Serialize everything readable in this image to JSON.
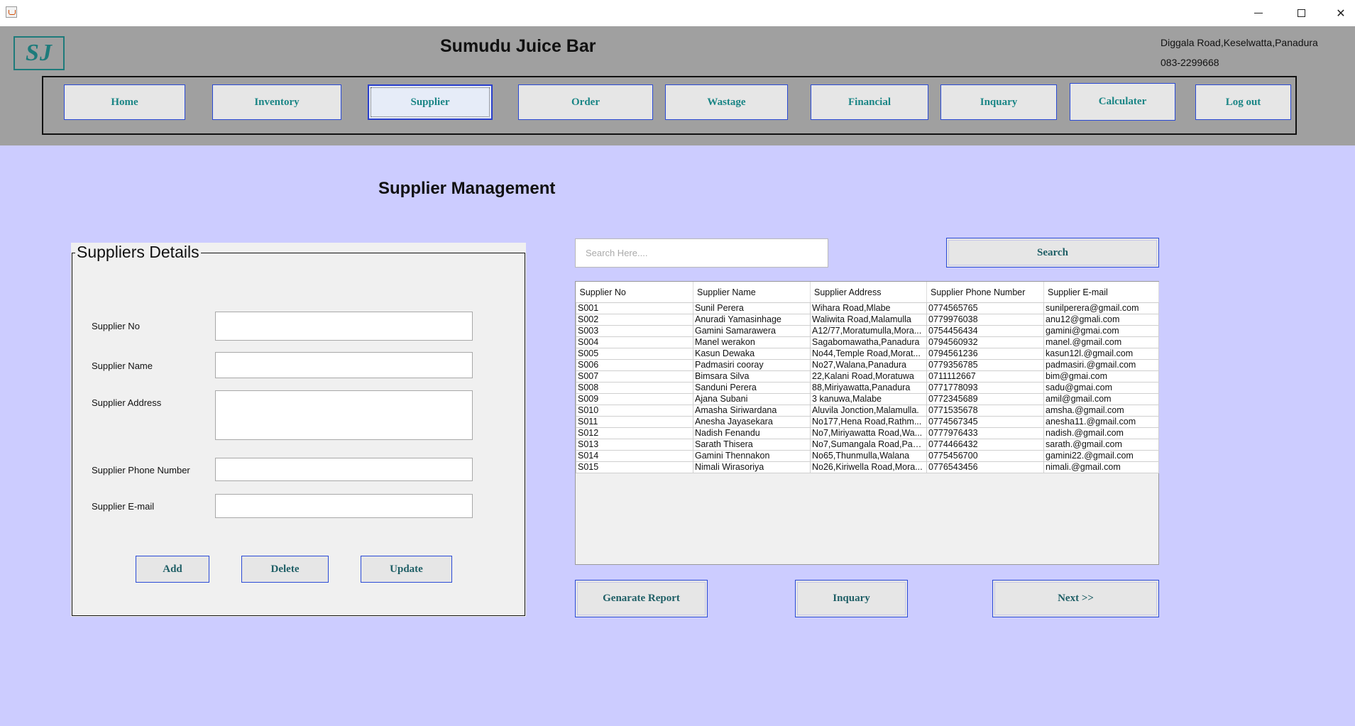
{
  "window": {
    "minimize_glyph": "",
    "maximize_glyph": "",
    "close_glyph": "✕"
  },
  "header": {
    "logo_text": "SJ",
    "title": "Sumudu Juice Bar",
    "address": "Diggala Road,Keselwatta,Panadura",
    "phone": "083-2299668"
  },
  "nav": {
    "items": [
      {
        "label": "Home"
      },
      {
        "label": "Inventory"
      },
      {
        "label": "Supplier"
      },
      {
        "label": "Order"
      },
      {
        "label": "Wastage"
      },
      {
        "label": "Financial"
      },
      {
        "label": "Inquary"
      },
      {
        "label": "Calculater"
      },
      {
        "label": "Log out"
      }
    ],
    "active": "Supplier"
  },
  "page_title": "Supplier Management",
  "form": {
    "legend": "Suppliers Details",
    "fields": [
      {
        "label": "Supplier No",
        "value": ""
      },
      {
        "label": "Supplier Name",
        "value": ""
      },
      {
        "label": "Supplier Address",
        "value": ""
      },
      {
        "label": "Supplier Phone Number",
        "value": ""
      },
      {
        "label": "Supplier E-mail",
        "value": ""
      }
    ],
    "buttons": {
      "add": "Add",
      "delete": "Delete",
      "update": "Update"
    }
  },
  "search": {
    "placeholder": "Search Here....",
    "button": "Search"
  },
  "table": {
    "columns": [
      "Supplier No",
      "Supplier Name",
      "Supplier Address",
      "Supplier Phone Number",
      "Supplier E-mail"
    ],
    "rows": [
      [
        "S001",
        "Sunil Perera",
        "Wihara Road,Mlabe",
        "0774565765",
        "sunilperera@gmail.com"
      ],
      [
        "S002",
        "Anuradi Yamasinhage",
        "Waliwita Road,Malamulla",
        "0779976038",
        "anu12@gmali.com"
      ],
      [
        "S003",
        "Gamini Samarawera",
        "A12/77,Moratumulla,Mora...",
        "0754456434",
        "gamini@gmai.com"
      ],
      [
        "S004",
        "Manel werakon",
        "Sagabomawatha,Panadura",
        "0794560932",
        "manel.@gmail.com"
      ],
      [
        "S005",
        "Kasun Dewaka",
        "No44,Temple Road,Morat...",
        "0794561236",
        "kasun12l.@gmail.com"
      ],
      [
        "S006",
        "Padmasiri cooray",
        "No27,Walana,Panadura",
        "0779356785",
        "padmasiri.@gmail.com"
      ],
      [
        "S007",
        "Bimsara Silva",
        "22,Kalani Road,Moratuwa",
        "0711112667",
        "bim@gmai.com"
      ],
      [
        "S008",
        "Sanduni Perera",
        "88,Miriyawatta,Panadura",
        "0771778093",
        "sadu@gmai.com"
      ],
      [
        "S009",
        "Ajana Subani",
        "3 kanuwa,Malabe",
        "0772345689",
        "amil@gmail.com"
      ],
      [
        "S010",
        "Amasha Siriwardana",
        "Aluvila Jonction,Malamulla.",
        "0771535678",
        "amsha.@gmail.com"
      ],
      [
        "S011",
        "Anesha Jayasekara",
        "No177,Hena Road,Rathm...",
        "0774567345",
        "anesha11.@gmail.com"
      ],
      [
        "S012",
        "Nadish Fenandu",
        "No7,Miriyawatta Road,Wa...",
        "0777976433",
        "nadish.@gmail.com"
      ],
      [
        "S013",
        "Sarath Thisera",
        "No7,Sumangala Road,Pan...",
        "0774466432",
        "sarath.@gmail.com"
      ],
      [
        "S014",
        "Gamini Thennakon",
        "No65,Thunmulla,Walana",
        "0775456700",
        "gamini22.@gmail.com"
      ],
      [
        "S015",
        "Nimali Wirasoriya",
        "No26,Kiriwella Road,Mora...",
        "0776543456",
        "nimali.@gmail.com"
      ]
    ]
  },
  "actions": {
    "report": "Genarate Report",
    "inquiry": "Inquary",
    "next": "Next >>"
  },
  "colors": {
    "background": "#ccccff",
    "header": "#a0a0a0",
    "accent_teal": "#1a8585",
    "button_border": "#2a4ad6"
  }
}
